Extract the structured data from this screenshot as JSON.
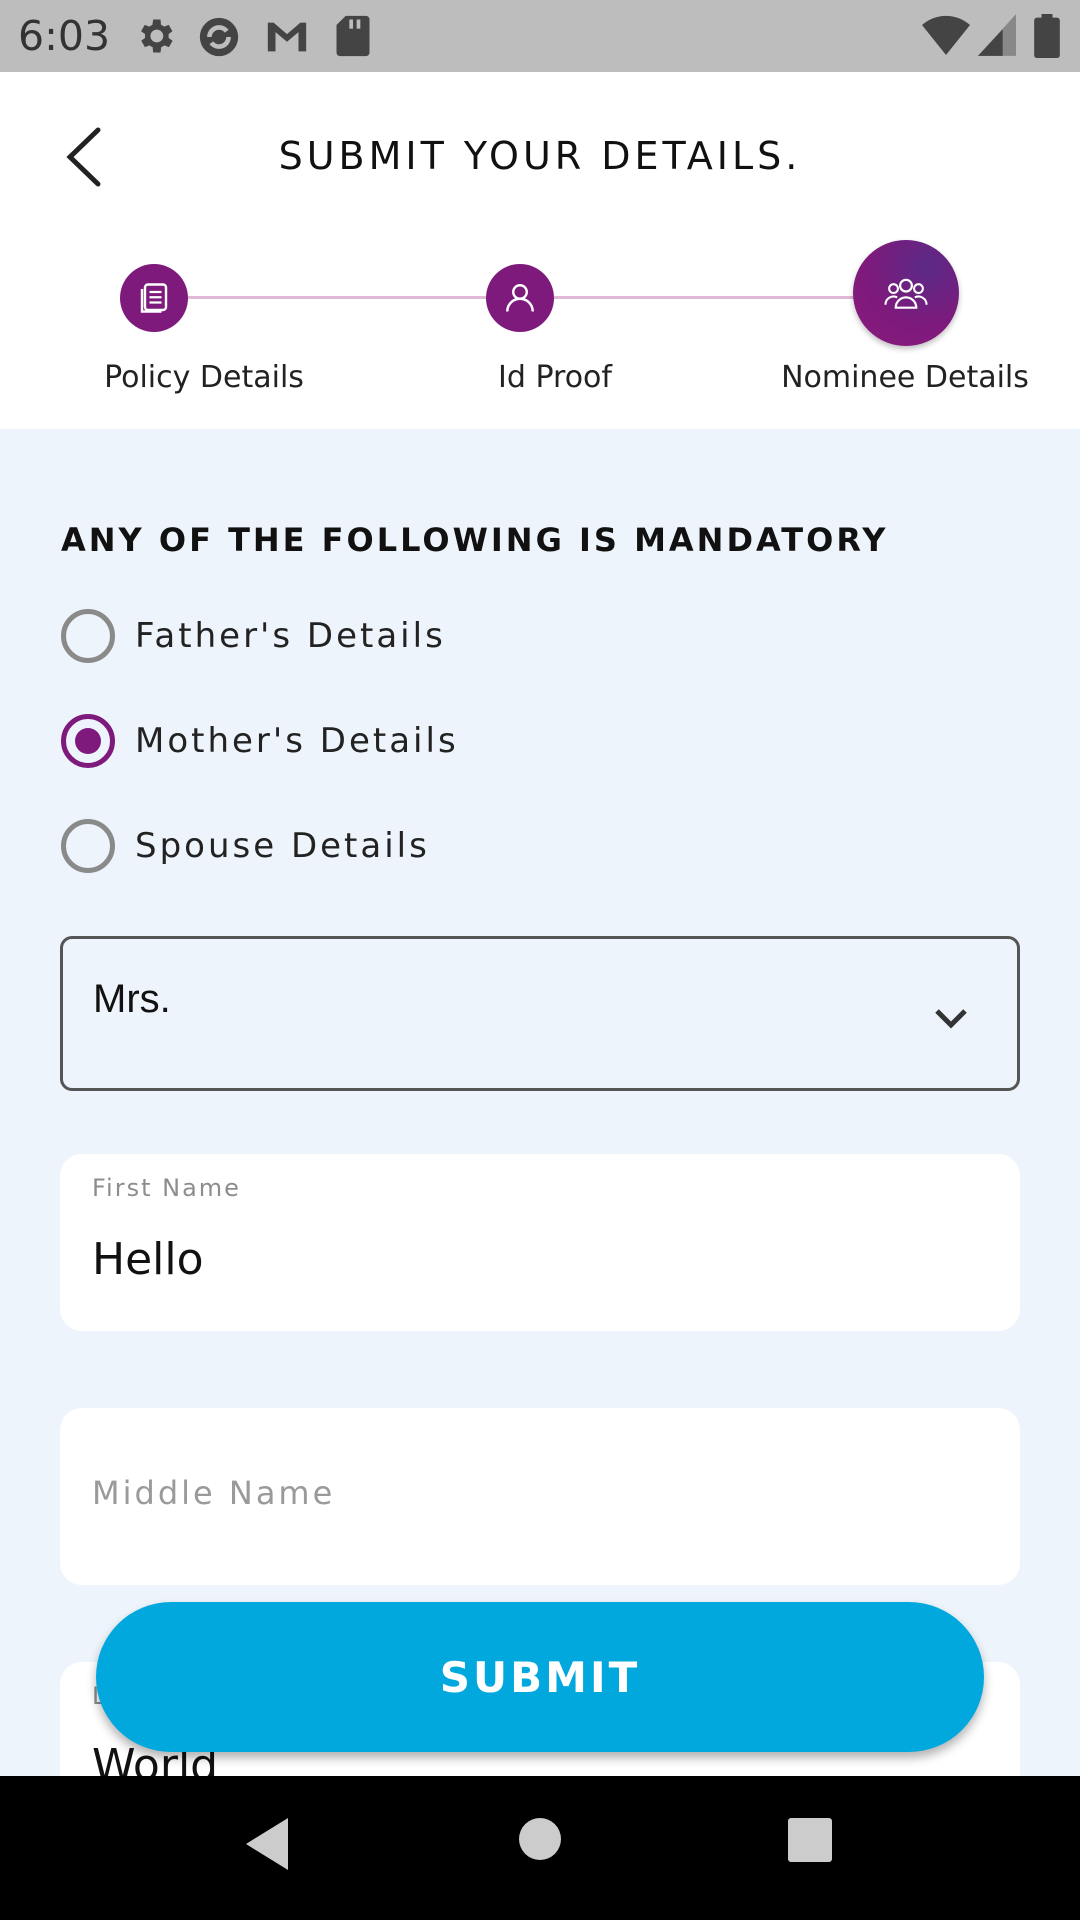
{
  "status_bar": {
    "time": "6:03",
    "icons": [
      "gear-icon",
      "sync-icon",
      "gmail-icon",
      "sd-card-icon",
      "wifi-icon",
      "signal-icon",
      "battery-icon"
    ]
  },
  "header": {
    "title": "SUBMIT YOUR DETAILS.",
    "back_icon": "back-arrow-icon",
    "steps": [
      {
        "label": "Policy Details",
        "icon": "document-icon",
        "state": "done"
      },
      {
        "label": "Id Proof",
        "icon": "person-icon",
        "state": "done"
      },
      {
        "label": "Nominee Details",
        "icon": "group-icon",
        "state": "active"
      }
    ]
  },
  "form": {
    "heading": "ANY OF THE FOLLOWING IS MANDATORY",
    "options": [
      {
        "label": "Father's Details",
        "selected": false
      },
      {
        "label": "Mother's Details",
        "selected": true
      },
      {
        "label": "Spouse Details",
        "selected": false
      }
    ],
    "salutation": {
      "value": "Mrs."
    },
    "first_name": {
      "label": "First Name",
      "value": "Hello"
    },
    "middle_name": {
      "placeholder": "Middle Name"
    },
    "last_name": {
      "label_partial": "L",
      "value": "World"
    },
    "submit_label": "SUBMIT"
  },
  "colors": {
    "accent": "#7d1a7c",
    "submit": "#00a8de",
    "form_bg": "#eef4fb"
  },
  "nav_bar": {
    "icons": [
      "nav-back-icon",
      "nav-home-icon",
      "nav-recents-icon"
    ]
  }
}
